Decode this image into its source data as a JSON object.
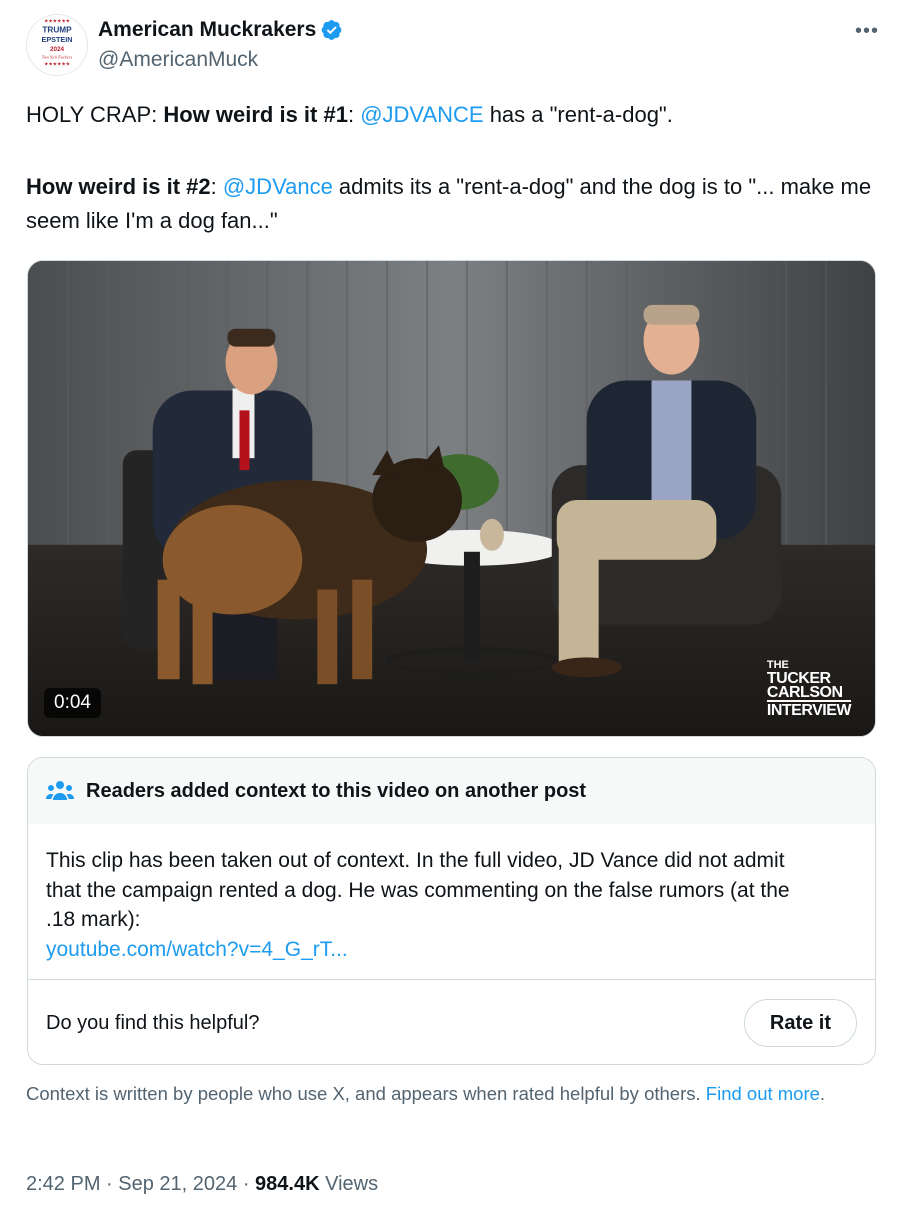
{
  "author": {
    "display_name": "American Muckrakers",
    "handle": "@AmericanMuck",
    "verified": true,
    "avatar_text": [
      "TRUMP",
      "EPSTEIN",
      "2024",
      "Two Sick Fuckers"
    ]
  },
  "tweet": {
    "line1": {
      "prefix": "HOLY CRAP:  ",
      "bold": "How weird is it #1",
      "colon": ":  ",
      "mention": "@JDVANCE",
      "rest": " has a \"rent-a-dog\"."
    },
    "line2": {
      "bold": "How weird is it #2",
      "colon": ":  ",
      "mention": "@JDVance",
      "rest": " admits its a \"rent-a-dog\" and the dog is to \"... make me seem like I'm a dog fan...\""
    }
  },
  "video": {
    "timestamp": "0:04",
    "watermark": [
      "THE",
      "TUCKER",
      "CARLSON",
      "INTERVIEW"
    ]
  },
  "community_note": {
    "header": "Readers added context to this video on another post",
    "body": "This clip has been taken out of context. In the full video, JD Vance did not admit that the campaign rented a dog. He was commenting on the false rumors (at the .18 mark):",
    "link": "youtube.com/watch?v=4_G_rT...",
    "question": "Do you find this helpful?",
    "rate_label": "Rate it"
  },
  "context_footer": {
    "text": "Context is written by people who use X, and appears when rated helpful by others.  ",
    "link": "Find out more",
    "end": "."
  },
  "meta": {
    "time": "2:42 PM",
    "sep1": " · ",
    "date": "Sep 21, 2024",
    "sep2": " · ",
    "views_count": "984.4K",
    "views_label": " Views"
  },
  "colors": {
    "link": "#1d9bf0",
    "text": "#0f1419",
    "secondary": "#536471",
    "border": "#cfd9de"
  },
  "icons": [
    "verified-badge-icon",
    "more-icon",
    "people-icon"
  ]
}
